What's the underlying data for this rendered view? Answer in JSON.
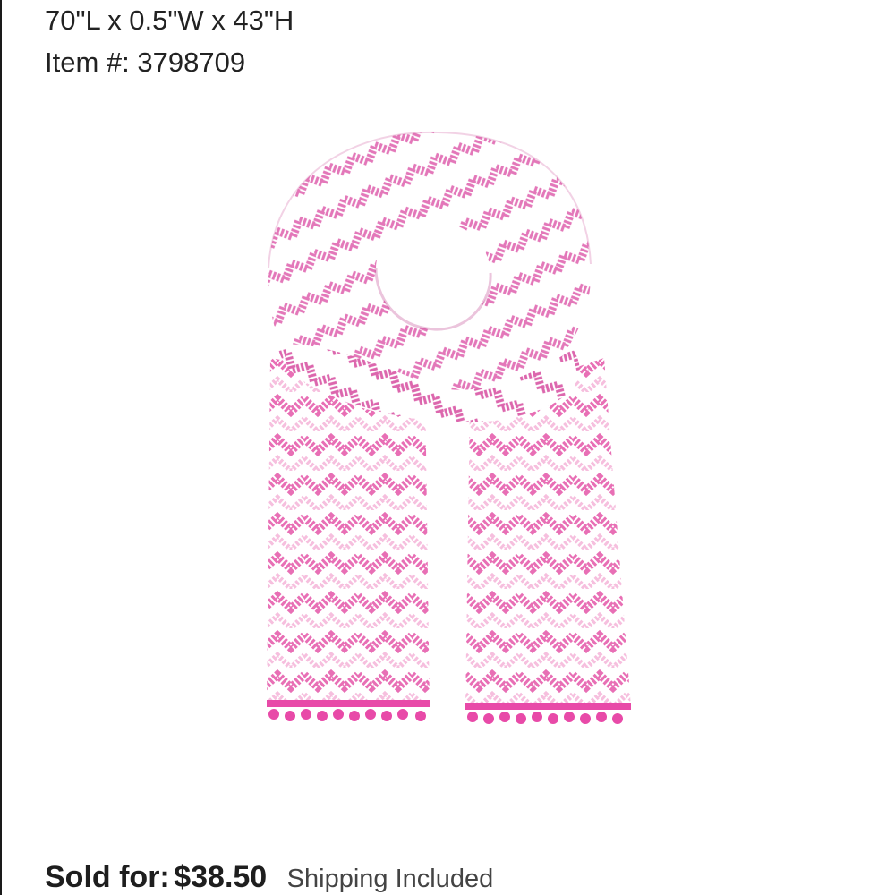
{
  "listing": {
    "dimensions": "70\"L x 0.5\"W x 43\"H",
    "item_number": "Item #: 3798709",
    "image": {
      "subject": "pink chevron scarf with pom-pom fringe",
      "colors": {
        "pink": "#e86fb5",
        "pink_dark": "#d94ea0",
        "fringe": "#e84aa8",
        "base": "#ffffff"
      }
    },
    "sold": {
      "label": "Sold for:",
      "price": "$38.50",
      "shipping": "Shipping Included"
    }
  }
}
